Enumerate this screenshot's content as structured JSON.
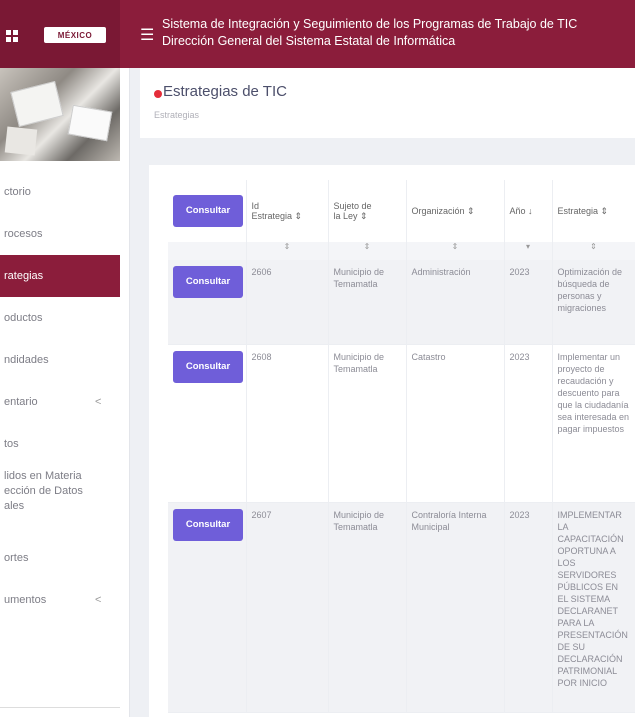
{
  "header": {
    "logo_text": "MÉXICO",
    "title_line1": "Sistema de Integración y Seguimiento de los Programas de Trabajo de TIC",
    "title_line2": "Dirección General del Sistema Estatal de Informática"
  },
  "sidebar": {
    "items": [
      {
        "label": "ctorio"
      },
      {
        "label": "rocesos"
      },
      {
        "label": "rategias"
      },
      {
        "label": "oductos"
      },
      {
        "label": "ndidades"
      },
      {
        "label": "entario"
      },
      {
        "label": "tos"
      },
      {
        "label": "lidos en Materia\nección de Datos\nales"
      },
      {
        "label": "ortes"
      },
      {
        "label": "umentos"
      }
    ],
    "chevron": "<"
  },
  "page": {
    "title": "Estrategias de TIC",
    "breadcrumb": "Estrategias"
  },
  "table": {
    "headers": [
      "Consultar",
      "Id\nEstrategia ⇕",
      "Sujeto de\nla Ley ⇕",
      "Organización ⇕",
      "Año ↓",
      "Estrategia ⇕"
    ],
    "filters": [
      "",
      "⇕",
      "⇕",
      "⇕",
      "▾",
      "⇕"
    ],
    "rows": [
      {
        "button": "Consultar",
        "id": "2606",
        "sujeto": "Municipio de Temamatla",
        "organizacion": "Administración",
        "anio": "2023",
        "estrategia": "Optimización de búsqueda de personas y migraciones"
      },
      {
        "button": "Consultar",
        "id": "2608",
        "sujeto": "Municipio de Temamatla",
        "organizacion": "Catastro",
        "anio": "2023",
        "estrategia": "Implementar un proyecto de recaudación y descuento para que la ciudadanía sea interesada en pagar impuestos"
      },
      {
        "button": "Consultar",
        "id": "2607",
        "sujeto": "Municipio de Temamatla",
        "organizacion": "Contraloría Interna Municipal",
        "anio": "2023",
        "estrategia": "IMPLEMENTAR LA CAPACITACIÓN OPORTUNA A LOS SERVIDORES PÚBLICOS EN EL SISTEMA DECLARANET PARA LA PRESENTACIÓN DE SU DECLARACIÓN PATRIMONIAL POR INICIO"
      }
    ]
  }
}
